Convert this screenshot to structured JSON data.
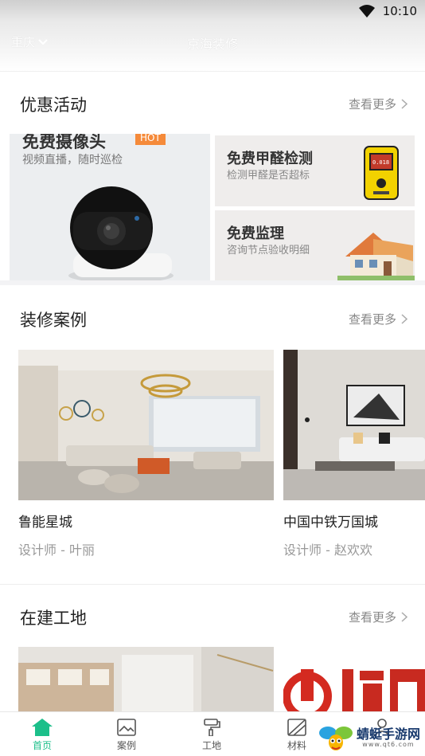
{
  "status_bar": {
    "time": "10:10"
  },
  "header": {
    "city": "重庆",
    "title": "京海装修"
  },
  "promotions": {
    "title": "优惠活动",
    "more": "查看更多",
    "items": [
      {
        "title": "免费摄像头",
        "badge": "HOT",
        "subtitle": "视频直播，随时巡检"
      },
      {
        "title": "免费甲醛检测",
        "subtitle": "检测甲醛是否超标",
        "device_text": "0.018"
      },
      {
        "title": "免费监理",
        "subtitle": "咨询节点验收明细"
      }
    ]
  },
  "cases": {
    "title": "装修案例",
    "more": "查看更多",
    "items": [
      {
        "name": "鲁能星城",
        "designer": "设计师 - 叶丽"
      },
      {
        "name": "中国中铁万国城",
        "designer": "设计师 - 赵欢欢"
      }
    ]
  },
  "sites": {
    "title": "在建工地",
    "more": "查看更多"
  },
  "tabbar": {
    "items": [
      {
        "label": "首页",
        "icon": "home-icon",
        "active": true
      },
      {
        "label": "案例",
        "icon": "picture-icon",
        "active": false
      },
      {
        "label": "工地",
        "icon": "paint-roller-icon",
        "active": false
      },
      {
        "label": "材料",
        "icon": "material-icon",
        "active": false
      },
      {
        "label": "",
        "icon": "user-icon",
        "active": false
      }
    ]
  },
  "watermark": {
    "name": "蜻蜓手游网",
    "url": "www.qt6.com"
  },
  "colors": {
    "accent": "#1cbf8a",
    "hot": "#f58a3a"
  }
}
